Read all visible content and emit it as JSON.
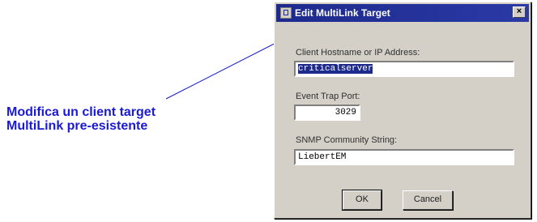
{
  "annotation": {
    "line1": "Modifica un client target",
    "line2": "MultiLink pre-esistente"
  },
  "dialog": {
    "title": "Edit MultiLink Target",
    "close_glyph": "×",
    "hostname_label": "Client Hostname or IP Address:",
    "hostname_value": "criticalserver",
    "port_label": "Event Trap Port:",
    "port_value": "3029",
    "community_label": "SNMP Community String:",
    "community_value": "LiebertEM",
    "ok_label": "OK",
    "cancel_label": "Cancel"
  },
  "colors": {
    "annotation_text": "#1a1ad4",
    "titlebar": "#1d2a8c",
    "dialog_bg": "#d4d0c8"
  },
  "icons": {
    "title": "window-icon",
    "close": "close-icon"
  }
}
